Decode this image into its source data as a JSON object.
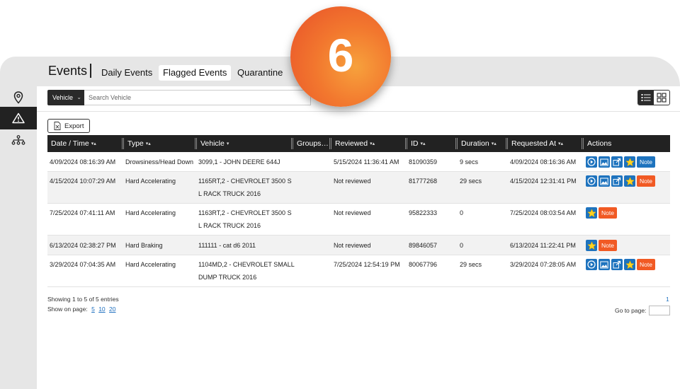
{
  "header": {
    "title": "Events",
    "tabs": [
      {
        "label": "Daily Events",
        "active": false
      },
      {
        "label": "Flagged Events",
        "active": true
      },
      {
        "label": "Quarantine",
        "active": false
      }
    ]
  },
  "badge": {
    "number": "6",
    "color": "#f2772e"
  },
  "sidebar": {
    "items": [
      {
        "icon": "map-pin-icon",
        "active": false
      },
      {
        "icon": "warning-icon",
        "active": true
      },
      {
        "icon": "org-chart-icon",
        "active": false
      }
    ]
  },
  "search": {
    "filter_label": "Vehicle",
    "placeholder": "Search Vehicle"
  },
  "toolbar": {
    "export_label": "Export"
  },
  "table": {
    "columns": [
      "Date / Time",
      "Type",
      "Vehicle",
      "Groups…",
      "Reviewed",
      "ID",
      "Duration",
      "Requested At",
      "Actions"
    ],
    "rows": [
      {
        "date": "4/09/2024 08:16:39 AM",
        "type": "Drowsiness/Head Down",
        "vehicle": [
          "3099,1 - JOHN DEERE 644J"
        ],
        "groups": "",
        "reviewed": "5/15/2024 11:36:41 AM",
        "id": "81090359",
        "duration": "9 secs",
        "requested": "4/09/2024 08:16:36 AM",
        "actions": "full",
        "note": "Note",
        "note_color": "#1e73be"
      },
      {
        "date": "4/15/2024 10:07:29 AM",
        "type": "Hard Accelerating",
        "vehicle": [
          "1165RT,2 - CHEVROLET 3500 S",
          "L RACK TRUCK 2016"
        ],
        "groups": "",
        "reviewed": "Not reviewed",
        "id": "81777268",
        "duration": "29 secs",
        "requested": "4/15/2024 12:31:41 PM",
        "actions": "full",
        "note": "Note",
        "note_color": "#f15a24"
      },
      {
        "date": "7/25/2024 07:41:11 AM",
        "type": "Hard Accelerating",
        "vehicle": [
          "1163RT,2 - CHEVROLET 3500 S",
          "L RACK TRUCK 2016"
        ],
        "groups": "",
        "reviewed": "Not reviewed",
        "id": "95822333",
        "duration": "0",
        "requested": "7/25/2024 08:03:54 AM",
        "actions": "star",
        "note": "Note",
        "note_color": "#f15a24"
      },
      {
        "date": "6/13/2024 02:38:27 PM",
        "type": "Hard Braking",
        "vehicle": [
          "111111 - cat d6 2011"
        ],
        "groups": "",
        "reviewed": "Not reviewed",
        "id": "89846057",
        "duration": "0",
        "requested": "6/13/2024 11:22:41 PM",
        "actions": "star",
        "note": "Note",
        "note_color": "#f15a24"
      },
      {
        "date": "3/29/2024 07:04:35 AM",
        "type": "Hard Accelerating",
        "vehicle": [
          "1104MD,2 - CHEVROLET SMALL",
          "DUMP TRUCK 2016"
        ],
        "groups": "",
        "reviewed": "7/25/2024 12:54:19 PM",
        "id": "80067796",
        "duration": "29 secs",
        "requested": "3/29/2024 07:28:05 AM",
        "actions": "full",
        "note": "Note",
        "note_color": "#f15a24"
      }
    ]
  },
  "footer": {
    "entries": "Showing 1 to 5 of 5 entries",
    "show_label": "Show on page:",
    "page_sizes": [
      "5",
      "10",
      "20"
    ],
    "current_page": "1",
    "goto_label": "Go to page:"
  }
}
